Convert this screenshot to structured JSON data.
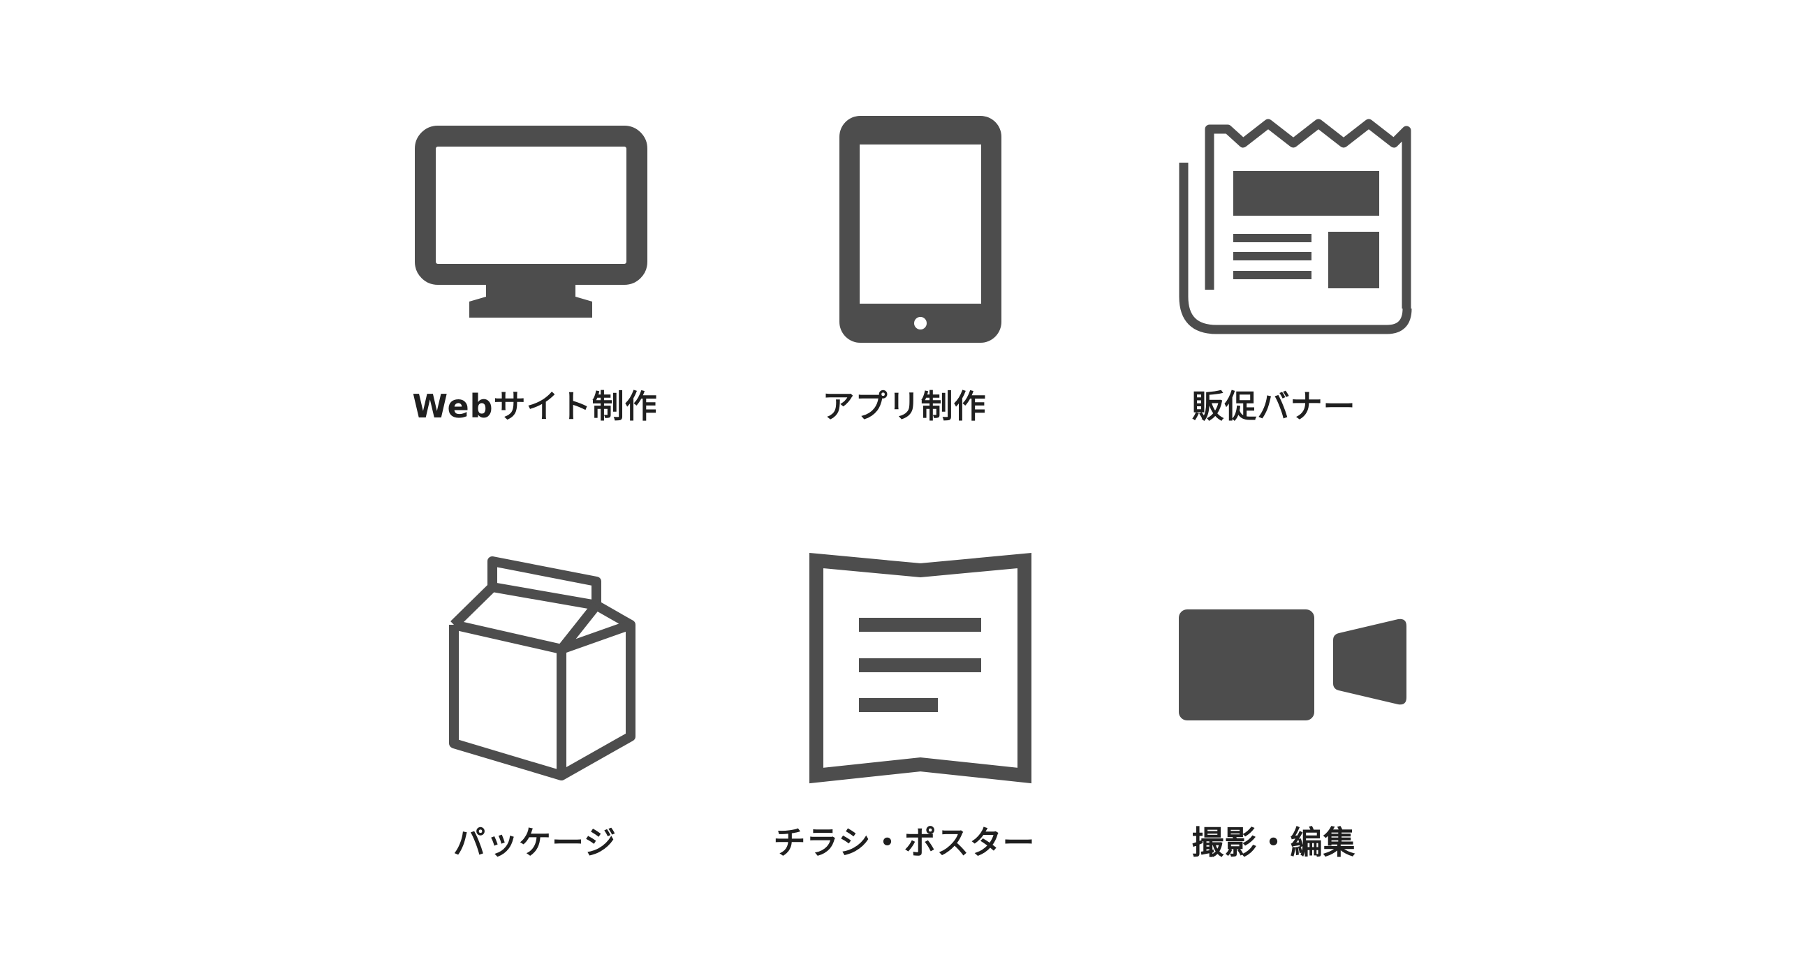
{
  "colors": {
    "icon": "#4d4d4d",
    "label": "#1f1f1f",
    "background": "#ffffff"
  },
  "services": [
    {
      "label": "Webサイト制作",
      "icon": "monitor-icon"
    },
    {
      "label": "アプリ制作",
      "icon": "tablet-icon"
    },
    {
      "label": "販促バナー",
      "icon": "newspaper-icon"
    },
    {
      "label": "パッケージ",
      "icon": "milk-carton-icon"
    },
    {
      "label": "チラシ・ポスター",
      "icon": "leaflet-icon"
    },
    {
      "label": "撮影・編集",
      "icon": "video-camera-icon"
    }
  ]
}
